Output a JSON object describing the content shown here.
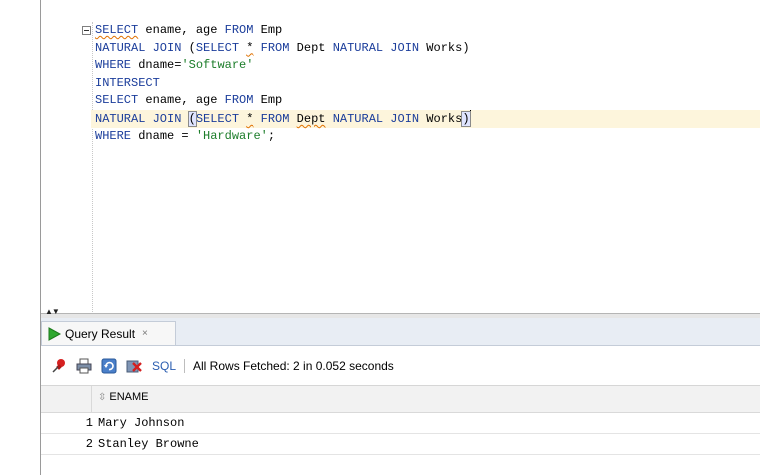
{
  "editor": {
    "lines": [
      [
        {
          "t": "SELECT",
          "c": "kw sq"
        },
        {
          "t": " ename, age "
        },
        {
          "t": "FROM",
          "c": "kw"
        },
        {
          "t": " Emp"
        }
      ],
      [
        {
          "t": "NATURAL JOIN",
          "c": "kw"
        },
        {
          "t": " ("
        },
        {
          "t": "SELECT",
          "c": "kw"
        },
        {
          "t": " "
        },
        {
          "t": "*",
          "c": "sq"
        },
        {
          "t": " "
        },
        {
          "t": "FROM",
          "c": "kw"
        },
        {
          "t": " Dept "
        },
        {
          "t": "NATURAL JOIN",
          "c": "kw"
        },
        {
          "t": " Works)"
        }
      ],
      [
        {
          "t": "WHERE",
          "c": "kw"
        },
        {
          "t": " dname="
        },
        {
          "t": "'Software'",
          "c": "str"
        }
      ],
      [
        {
          "t": "INTERSECT",
          "c": "kw"
        }
      ],
      [
        {
          "t": "SELECT",
          "c": "kw"
        },
        {
          "t": " ename, age "
        },
        {
          "t": "FROM",
          "c": "kw"
        },
        {
          "t": " Emp"
        }
      ],
      [
        {
          "t": "NATURAL JOIN",
          "c": "kw"
        },
        {
          "t": " "
        },
        {
          "t": "(",
          "c": "paren"
        },
        {
          "t": "SELECT",
          "c": "kw"
        },
        {
          "t": " "
        },
        {
          "t": "*",
          "c": "sq"
        },
        {
          "t": " "
        },
        {
          "t": "FROM",
          "c": "kw"
        },
        {
          "t": " "
        },
        {
          "t": "Dept",
          "c": "sq"
        },
        {
          "t": " "
        },
        {
          "t": "NATURAL JOIN",
          "c": "kw"
        },
        {
          "t": " Works"
        },
        {
          "t": ")",
          "c": "paren"
        },
        {
          "t": "",
          "c": "cursor"
        }
      ],
      [
        {
          "t": "WHERE",
          "c": "kw"
        },
        {
          "t": " dname = "
        },
        {
          "t": "'Hardware'",
          "c": "str"
        },
        {
          "t": ";"
        }
      ]
    ],
    "current_line": 5
  },
  "results": {
    "tab_label": "Query Result",
    "tab_close": "×",
    "sql_link": "SQL",
    "status": "All Rows Fetched: 2 in 0.052 seconds",
    "column_header": "ENAME",
    "rows": [
      {
        "num": "1",
        "ename": "Mary Johnson"
      },
      {
        "num": "2",
        "ename": "Stanley Browne"
      }
    ]
  },
  "icons": {
    "play": "play-icon",
    "pin": "pin-icon",
    "print": "print-icon",
    "refresh": "refresh-icon",
    "cancel": "cancel-icon",
    "sort": "sort-icon"
  },
  "colors": {
    "keyword": "#1b3d9b",
    "string": "#1c7d2a",
    "current_line": "#fdf5dc"
  }
}
